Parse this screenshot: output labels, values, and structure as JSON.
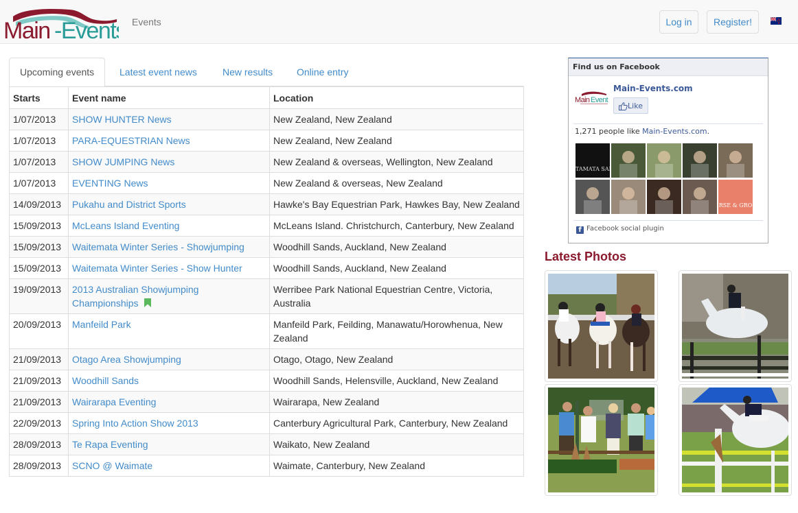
{
  "brand": {
    "name": "Main-Events",
    "colors": {
      "maroon": "#8b1a2e",
      "teal": "#2a9c98",
      "link": "#428bca"
    }
  },
  "nav": {
    "links": [
      {
        "label": "Events"
      }
    ],
    "login_label": "Log in",
    "register_label": "Register!",
    "flag_icon": "new-zealand-flag-icon"
  },
  "tabs": [
    {
      "label": "Upcoming events",
      "active": true
    },
    {
      "label": "Latest event news",
      "active": false
    },
    {
      "label": "New results",
      "active": false
    },
    {
      "label": "Online entry",
      "active": false
    }
  ],
  "table": {
    "headers": [
      "Starts",
      "Event name",
      "Location"
    ],
    "rows": [
      {
        "starts": "1/07/2013",
        "name": "SHOW HUNTER News",
        "location": "New Zealand, New Zealand"
      },
      {
        "starts": "1/07/2013",
        "name": "PARA-EQUESTRIAN News",
        "location": "New Zealand, New Zealand"
      },
      {
        "starts": "1/07/2013",
        "name": "SHOW JUMPING News",
        "location": "New Zealand & overseas, Wellington, New Zealand"
      },
      {
        "starts": "1/07/2013",
        "name": "EVENTING News",
        "location": "New Zealand & overseas, New Zealand"
      },
      {
        "starts": "14/09/2013",
        "name": "Pukahu and District Sports",
        "location": "Hawke's Bay Equestrian Park, Hawkes Bay, New Zealand"
      },
      {
        "starts": "15/09/2013",
        "name": "McLeans Island Eventing",
        "location": "McLeans Island. Christchurch, Canterbury, New Zealand"
      },
      {
        "starts": "15/09/2013",
        "name": "Waitemata Winter Series - Showjumping",
        "location": "Woodhill Sands, Auckland, New Zealand"
      },
      {
        "starts": "15/09/2013",
        "name": "Waitemata Winter Series - Show Hunter",
        "location": "Woodhill Sands, Auckland, New Zealand"
      },
      {
        "starts": "19/09/2013",
        "name": "2013 Australian Showjumping Championships",
        "location": "Werribee Park National Equestrian Centre, Victoria, Australia",
        "bookmark": true
      },
      {
        "starts": "20/09/2013",
        "name": "Manfeild Park",
        "location": "Manfeild Park, Feilding, Manawatu/Horowhenua, New Zealand"
      },
      {
        "starts": "21/09/2013",
        "name": "Otago Area Showjumping",
        "location": "Otago, Otago, New Zealand"
      },
      {
        "starts": "21/09/2013",
        "name": "Woodhill Sands",
        "location": "Woodhill Sands, Helensville, Auckland, New Zealand"
      },
      {
        "starts": "21/09/2013",
        "name": "Wairarapa Eventing",
        "location": "Wairarapa, New Zealand"
      },
      {
        "starts": "22/09/2013",
        "name": "Spring Into Action Show 2013",
        "location": "Canterbury Agricultural Park, Canterbury, New Zealand"
      },
      {
        "starts": "28/09/2013",
        "name": "Te Rapa Eventing",
        "location": "Waikato, New Zealand"
      },
      {
        "starts": "28/09/2013",
        "name": "SCNO @ Waimate",
        "location": "Waimate, Canterbury, New Zealand"
      }
    ]
  },
  "facebook": {
    "header": "Find us on Facebook",
    "page_name": "Main-Events.com",
    "like_label": "Like",
    "count_prefix": "1,271 people like ",
    "count_link": "Main-Events.com",
    "count_suffix": ".",
    "footer": "Facebook social plugin",
    "faces": [
      {
        "label": "TAMATA SADDL",
        "bg": "#111111",
        "fg": "#dddddd"
      },
      {
        "label": "",
        "bg": "#4a5a38",
        "fg": "#ffffff"
      },
      {
        "label": "",
        "bg": "#8a9a6a",
        "fg": "#ffffff"
      },
      {
        "label": "",
        "bg": "#3a4030",
        "fg": "#ffffff"
      },
      {
        "label": "",
        "bg": "#7a6a58",
        "fg": "#ffffff"
      },
      {
        "label": "",
        "bg": "#555555",
        "fg": "#ffffff"
      },
      {
        "label": "",
        "bg": "#9a8a7a",
        "fg": "#ffffff"
      },
      {
        "label": "",
        "bg": "#3a2a22",
        "fg": "#ffffff"
      },
      {
        "label": "",
        "bg": "#6a5a50",
        "fg": "#ffffff"
      },
      {
        "label": "RSE & GRO",
        "bg": "#e8806a",
        "fg": "#ffffff"
      }
    ]
  },
  "photos": {
    "title": "Latest Photos",
    "items": [
      {
        "alt": "riders-on-horses-photo"
      },
      {
        "alt": "white-horse-jumping-photo"
      },
      {
        "alt": "group-of-people-photo"
      },
      {
        "alt": "showjumping-photo"
      }
    ]
  }
}
